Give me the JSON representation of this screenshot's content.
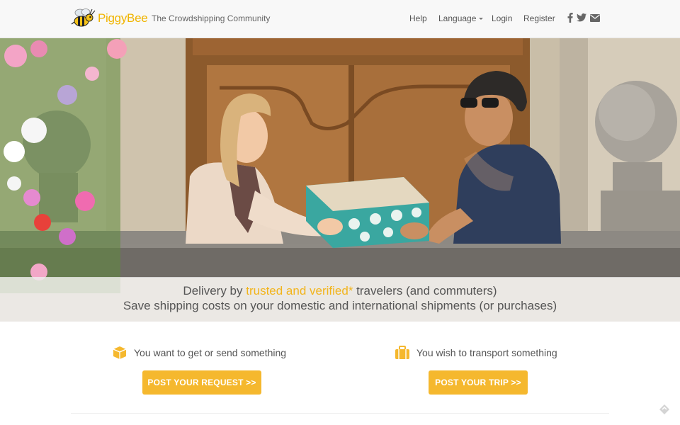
{
  "header": {
    "brand_name": "PiggyBee",
    "tagline": "The Crowdshipping Community",
    "nav": {
      "help": "Help",
      "language": "Language",
      "login": "Login",
      "register": "Register"
    },
    "social_icons": [
      "facebook-icon",
      "twitter-icon",
      "envelope-icon"
    ]
  },
  "hero": {
    "line1_prefix": "Delivery by ",
    "line1_highlight": "trusted and verified*",
    "line1_suffix": " travelers (and commuters)",
    "line2": "Save shipping costs on your domestic and international shipments (or purchases)"
  },
  "actions": {
    "sender": {
      "label": "You want to get or send something",
      "icon": "box-icon",
      "button": "POST YOUR REQUEST >>"
    },
    "traveler": {
      "label": "You wish to transport something",
      "icon": "suitcase-icon",
      "button": "POST YOUR TRIP >>"
    }
  },
  "colors": {
    "accent": "#f5b82e",
    "highlight": "#f2b41b",
    "text": "#555555",
    "navbar_bg": "#f8f8f8"
  }
}
